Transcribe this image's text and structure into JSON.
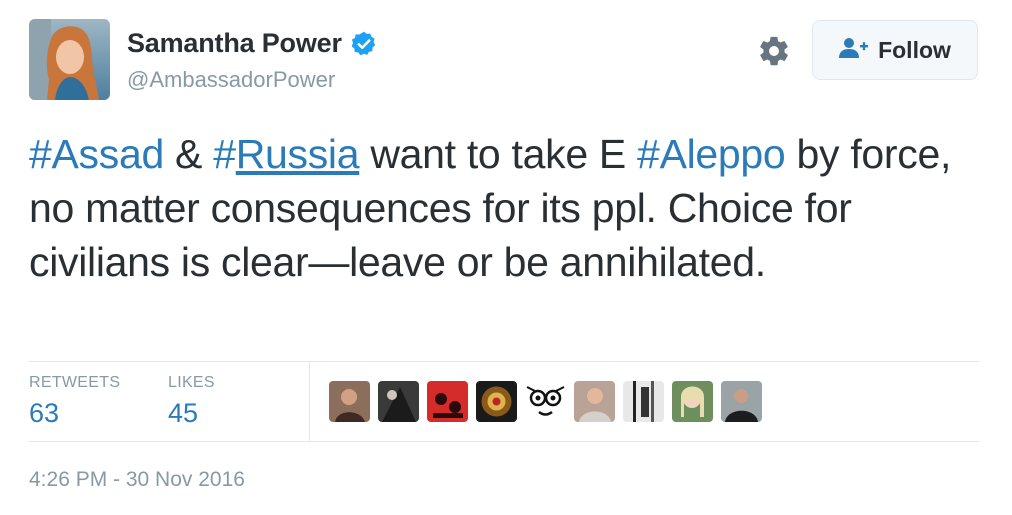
{
  "user": {
    "name": "Samantha Power",
    "handle": "@AmbassadorPower"
  },
  "follow_button": {
    "label": "Follow"
  },
  "tweet": {
    "seg1": "#",
    "seg1_word": "Assad",
    "seg2": " & ",
    "seg3": "#",
    "seg3_word": "Russia",
    "seg4": " want to take E ",
    "seg5": "#",
    "seg5_word": "Aleppo",
    "seg6": " by force, no matter consequences for its ppl. Choice for civilians is clear—leave or be annihilated."
  },
  "stats": {
    "retweets_label": "RETWEETS",
    "retweets_value": "63",
    "likes_label": "LIKES",
    "likes_value": "45"
  },
  "timestamp": "4:26 PM - 30 Nov 2016",
  "colors": {
    "link": "#2b7bb9",
    "muted": "#8899a6",
    "verified": "#1da1f2"
  }
}
